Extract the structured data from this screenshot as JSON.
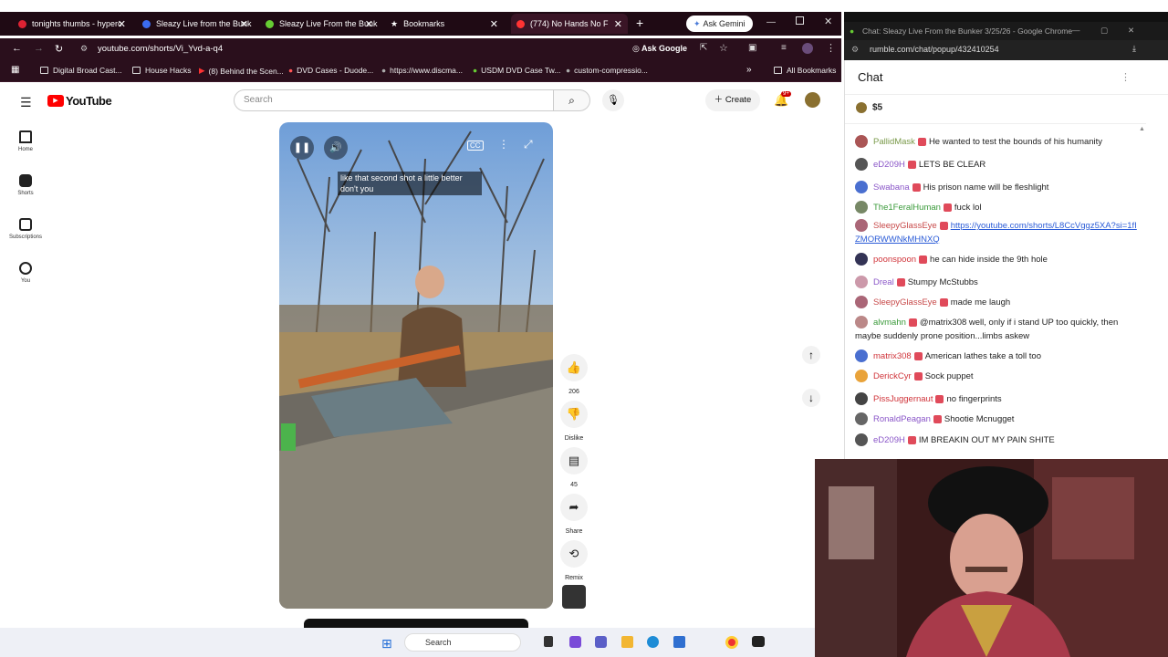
{
  "tabs": [
    {
      "label": "tonights thumbs - hyperc",
      "color": "#d23"
    },
    {
      "label": "Sleazy Live from the Bunk",
      "color": "#3b6cf0"
    },
    {
      "label": "Sleazy Live From the Bunk",
      "color": "#6c3"
    },
    {
      "label": "Bookmarks",
      "color": "#ccc"
    },
    {
      "label": "(774) No Hands No F",
      "color": "#f33"
    }
  ],
  "ask_gemini": "Ask Gemini",
  "address": "youtube.com/shorts/Vi_Yvd-a-q4",
  "ask_google": "Ask Google",
  "bookmarks": [
    "Digital Broad Cast...",
    "House Hacks",
    "(8) Behind the Scen...",
    "DVD Cases - Duode...",
    "https://www.discma...",
    "USDM DVD Case Tw...",
    "custom-compressio..."
  ],
  "all_bookmarks": "All Bookmarks",
  "yt": {
    "logo": "YouTube",
    "search_placeholder": "Search",
    "create": "Create",
    "notif_count": "9+",
    "nav": [
      "Home",
      "Shorts",
      "Subscriptions",
      "You"
    ],
    "caption": "like that second shot a little better don't you",
    "like_count": "206",
    "dislike": "Dislike",
    "comments": "45",
    "share": "Share",
    "remix": "Remix"
  },
  "chat": {
    "window_title": "Chat: Sleazy Live From the Bunker 3/25/26 - Google Chrome",
    "url": "rumble.com/chat/popup/432410254",
    "title": "Chat",
    "tip": "$5",
    "messages": [
      {
        "user": "PallidMask",
        "text": "He wanted to test the bounds of his humanity",
        "color": "#7a9a4a",
        "av": "#a55"
      },
      {
        "user": "eD209H",
        "text": "LETS BE CLEAR",
        "color": "#8a56c8",
        "av": "#555"
      },
      {
        "user": "Swabana",
        "text": "His prison name will be fleshlight",
        "color": "#8a56c8",
        "av": "#4a6fd0"
      },
      {
        "user": "The1FeralHuman",
        "text": "fuck lol",
        "color": "#3a9a3a",
        "av": "#786"
      },
      {
        "user": "SleepyGlassEye",
        "text": "https://youtube.com/shorts/L8CcVggz5XA?si=1fIZMORWWNkMHNXQ",
        "color": "#c84a4a",
        "av": "#a67"
      },
      {
        "user": "poonspoon",
        "text": "he can hide inside the 9th hole",
        "color": "#d0343a",
        "av": "#335"
      },
      {
        "user": "Dreal",
        "text": "Stumpy McStubbs",
        "color": "#8a56c8",
        "av": "#c9a"
      },
      {
        "user": "SleepyGlassEye",
        "text": "made me laugh",
        "color": "#c84a4a",
        "av": "#a67"
      },
      {
        "user": "alvmahn",
        "text": "@matrix308 well, only if i stand UP too quickly, then maybe suddenly prone position...limbs askew",
        "color": "#3a9a3a",
        "av": "#b88"
      },
      {
        "user": "matrix308",
        "text": "American lathes take a toll too",
        "color": "#d0343a",
        "av": "#4a6fd0"
      },
      {
        "user": "DerickCyr",
        "text": "Sock puppet",
        "color": "#d0343a",
        "av": "#e9a33a"
      },
      {
        "user": "PissJuggernaut",
        "text": "no fingerprints",
        "color": "#d0343a",
        "av": "#444"
      },
      {
        "user": "RonaldPeagan",
        "text": "Shootie Mcnugget",
        "color": "#8a56c8",
        "av": "#666"
      },
      {
        "user": "eD209H",
        "text": "IM BREAKIN OUT MY PAIN SHITE",
        "color": "#8a56c8",
        "av": "#555"
      }
    ]
  },
  "taskbar": {
    "search": "Search"
  }
}
